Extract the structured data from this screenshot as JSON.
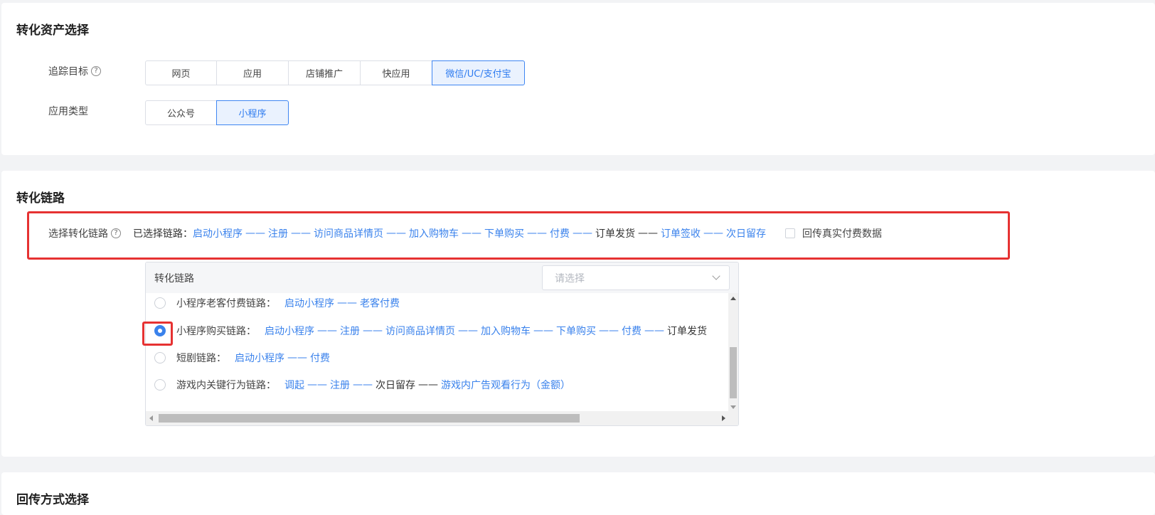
{
  "section1": {
    "title": "转化资产选择",
    "tracking_target": {
      "label": "追踪目标",
      "help": "?",
      "options": [
        "网页",
        "应用",
        "店铺推广",
        "快应用",
        "微信/UC/支付宝"
      ],
      "selected": "微信/UC/支付宝"
    },
    "app_type": {
      "label": "应用类型",
      "options": [
        "公众号",
        "小程序"
      ],
      "selected": "小程序"
    }
  },
  "section2": {
    "title": "转化链路",
    "chain_label": "选择转化链路",
    "help": "?",
    "selected_prefix": "已选择链路：",
    "selected_steps": [
      {
        "text": "启动小程序",
        "color": "blue"
      },
      {
        "text": "注册",
        "color": "blue"
      },
      {
        "text": "访问商品详情页",
        "color": "blue"
      },
      {
        "text": "加入购物车",
        "color": "blue"
      },
      {
        "text": "下单购买",
        "color": "blue"
      },
      {
        "text": "付费",
        "color": "blue"
      },
      {
        "text": "订单发货",
        "color": "dark"
      },
      {
        "text": "订单签收",
        "color": "blue"
      },
      {
        "text": "次日留存",
        "color": "blue"
      }
    ],
    "arrow": "——",
    "checkbox_label": "回传真实付费数据",
    "panel": {
      "header": "转化链路",
      "select_placeholder": "请选择",
      "options": [
        {
          "name": "小程序老客付费链路：",
          "checked": false,
          "steps": [
            {
              "text": "启动小程序",
              "color": "blue"
            },
            {
              "text": "老客付费",
              "color": "blue"
            }
          ]
        },
        {
          "name": "小程序购买链路：",
          "checked": true,
          "steps": [
            {
              "text": "启动小程序",
              "color": "blue"
            },
            {
              "text": "注册",
              "color": "blue"
            },
            {
              "text": "访问商品详情页",
              "color": "blue"
            },
            {
              "text": "加入购物车",
              "color": "blue"
            },
            {
              "text": "下单购买",
              "color": "blue"
            },
            {
              "text": "付费",
              "color": "blue"
            },
            {
              "text": "订单发货",
              "color": "dark"
            }
          ]
        },
        {
          "name": "短剧链路：",
          "checked": false,
          "steps": [
            {
              "text": "启动小程序",
              "color": "blue"
            },
            {
              "text": "付费",
              "color": "blue"
            }
          ]
        },
        {
          "name": "游戏内关键行为链路：",
          "checked": false,
          "steps": [
            {
              "text": "调起",
              "color": "blue"
            },
            {
              "text": "注册",
              "color": "blue"
            },
            {
              "text": "次日留存",
              "color": "dark"
            },
            {
              "text": "游戏内广告观看行为（金额）",
              "color": "blue"
            }
          ]
        }
      ]
    }
  },
  "section3": {
    "title": "回传方式选择"
  },
  "colors": {
    "accent": "#3a82ec",
    "highlight": "#e63232",
    "active_bg": "#eaf2fe"
  }
}
